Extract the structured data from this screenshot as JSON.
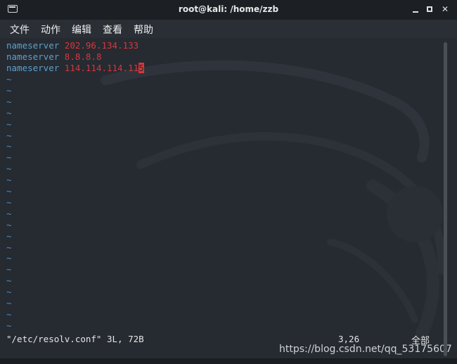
{
  "window": {
    "title": "root@kali: /home/zzb",
    "buttons": {
      "minimize": "minimize",
      "maximize": "maximize",
      "close": "✕"
    }
  },
  "menu": {
    "items": [
      "文件",
      "动作",
      "编辑",
      "查看",
      "帮助"
    ]
  },
  "editor": {
    "lines": [
      {
        "keyword": "nameserver",
        "value": "202.96.134.133"
      },
      {
        "keyword": "nameserver",
        "value": "8.8.8.8"
      },
      {
        "keyword": "nameserver",
        "value": "114.114.114.11",
        "cursor_char": "5"
      }
    ],
    "tilde": "~",
    "tilde_count": 23
  },
  "statusline": {
    "file_info": "\"/etc/resolv.conf\" 3L, 72B",
    "position": "3,26",
    "scroll": "全部"
  },
  "watermark": "https://blog.csdn.net/qq_53175607",
  "colors": {
    "keyword": "#5aa1cf",
    "value": "#d8363a",
    "tilde": "#4a8fc4",
    "background": "#262a31"
  }
}
